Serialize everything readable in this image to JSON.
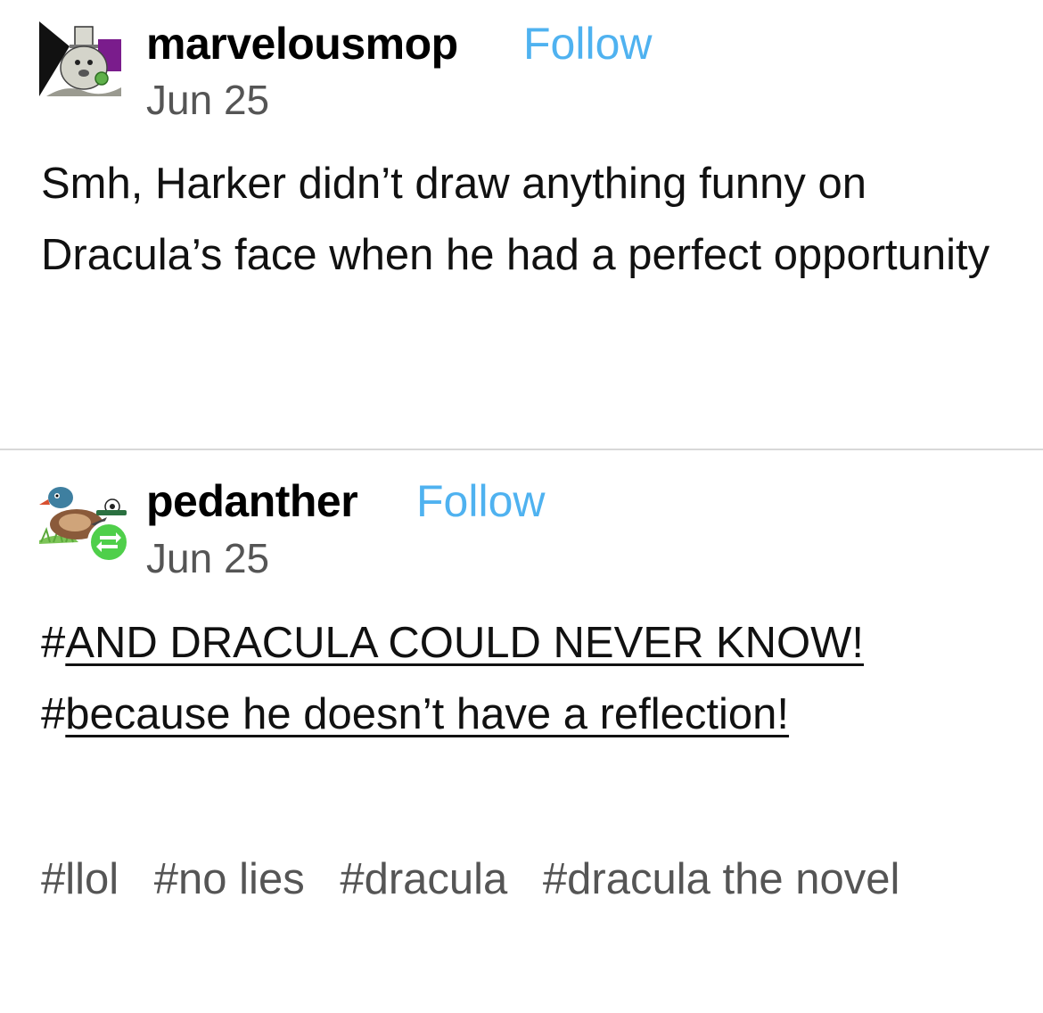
{
  "post1": {
    "username": "marvelousmop",
    "follow_label": "Follow",
    "date": "Jun 25",
    "text": "Smh, Harker didn’t draw anything funny on Dracula’s face when he had a perfect opportunity"
  },
  "post2": {
    "username": "pedanther",
    "follow_label": "Follow",
    "date": "Jun 25",
    "hashtags_big": [
      {
        "hash": "#",
        "text": "AND DRACULA COULD NEVER KNOW!"
      },
      {
        "hash": "#",
        "text": "because he doesn’t have a reflection!"
      }
    ],
    "tags": [
      "#llol",
      "#no lies",
      "#dracula",
      "#dracula the novel"
    ]
  },
  "colors": {
    "follow": "#4fb2f0",
    "reblog_badge": "#4fcf4a",
    "avatar1_purple": "#7a1c8c",
    "divider": "#d8d8d8"
  },
  "icons": {
    "avatar1": "top-hat-raccoon-avatar",
    "avatar2": "duck-avatar",
    "reblog": "reblog-icon"
  }
}
